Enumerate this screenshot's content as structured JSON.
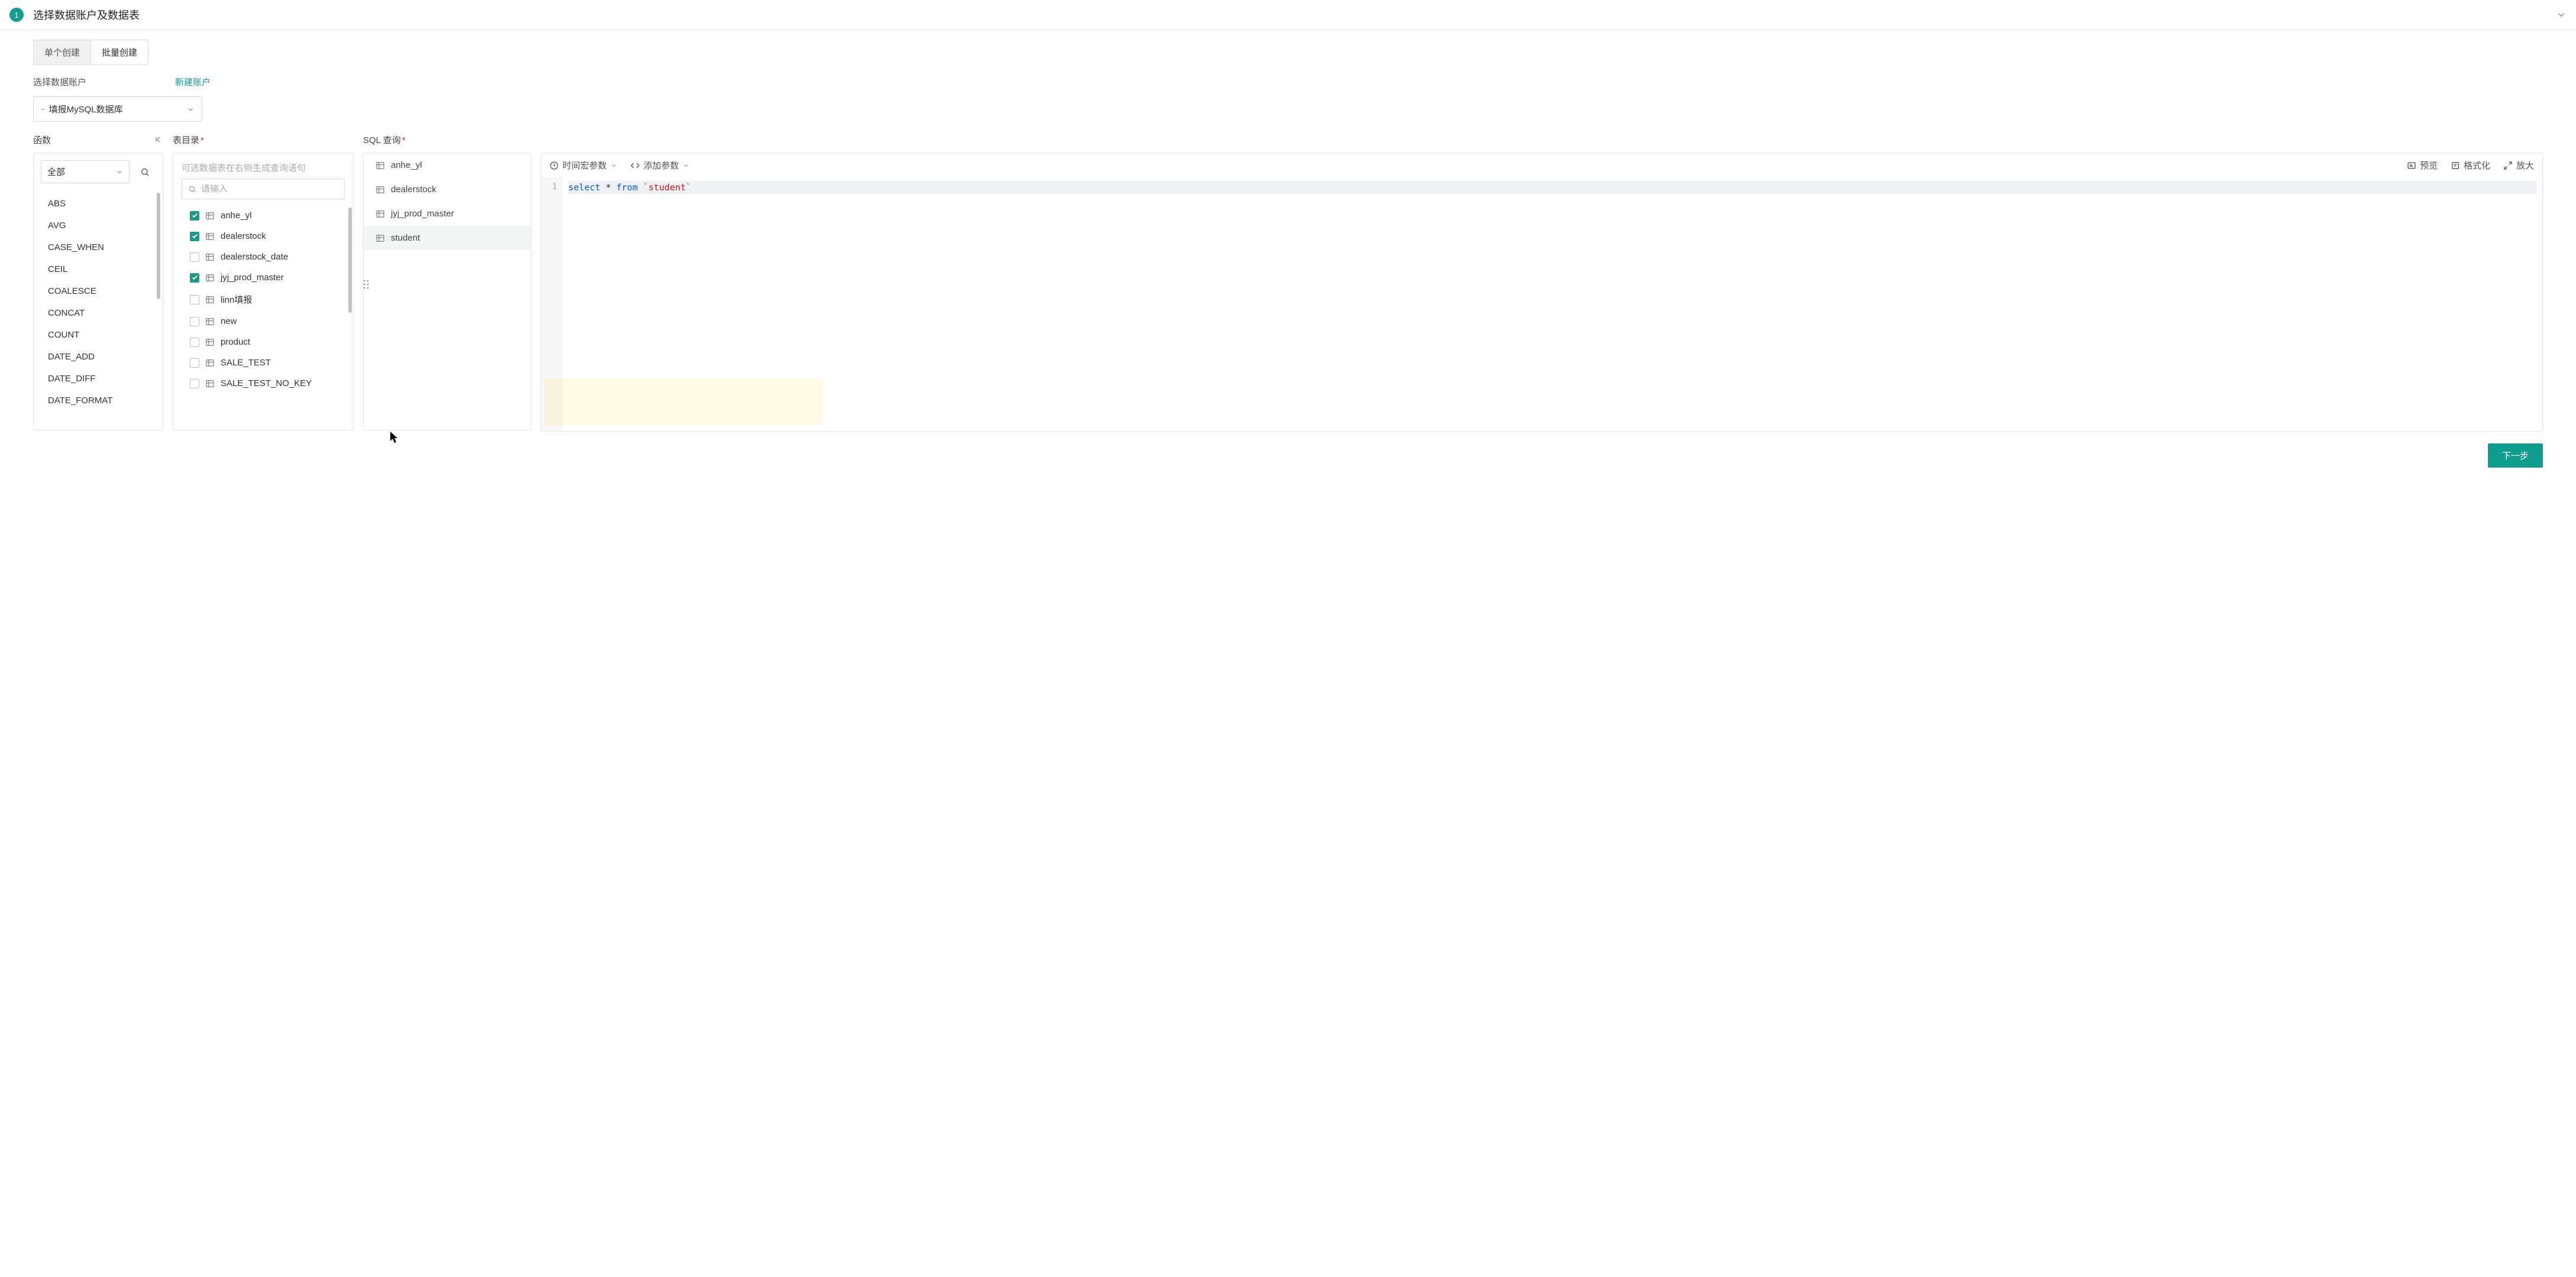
{
  "header": {
    "step": "1",
    "title": "选择数据账户及数据表"
  },
  "tabs": {
    "single": "单个创建",
    "batch": "批量创建",
    "active": 0
  },
  "account": {
    "label": "选择数据账户",
    "new_link": "新建账户",
    "selected": "填报MySQL数据库"
  },
  "functions": {
    "title": "函数",
    "filter_selected": "全部",
    "list": [
      "ABS",
      "AVG",
      "CASE_WHEN",
      "CEIL",
      "COALESCE",
      "CONCAT",
      "COUNT",
      "DATE_ADD",
      "DATE_DIFF",
      "DATE_FORMAT"
    ]
  },
  "tables_dir": {
    "title": "表目录",
    "hint": "可选数据表在右侧生成查询语句",
    "search_placeholder": "请输入",
    "items": [
      {
        "name": "anhe_yl",
        "checked": true
      },
      {
        "name": "dealerstock",
        "checked": true
      },
      {
        "name": "dealerstock_date",
        "checked": false
      },
      {
        "name": "jyj_prod_master",
        "checked": true
      },
      {
        "name": "linn填报",
        "checked": false
      },
      {
        "name": "new",
        "checked": false
      },
      {
        "name": "product",
        "checked": false
      },
      {
        "name": "SALE_TEST",
        "checked": false
      },
      {
        "name": "SALE_TEST_NO_KEY",
        "checked": false
      }
    ]
  },
  "sql_panel": {
    "title": "SQL 查询",
    "toolbar": {
      "time_macro": "时间宏参数",
      "add_param": "添加参数",
      "preview": "预览",
      "format": "格式化",
      "expand": "放大"
    },
    "selected_tables": [
      {
        "name": "anhe_yl",
        "active": false
      },
      {
        "name": "dealerstock",
        "active": false
      },
      {
        "name": "jyj_prod_master",
        "active": false
      },
      {
        "name": "student",
        "active": true
      }
    ],
    "code": {
      "line_no": "1",
      "select": "select",
      "star": " * ",
      "from": "from",
      "space": " ",
      "table_lit": "`student`"
    }
  },
  "footer": {
    "next": "下一步"
  }
}
